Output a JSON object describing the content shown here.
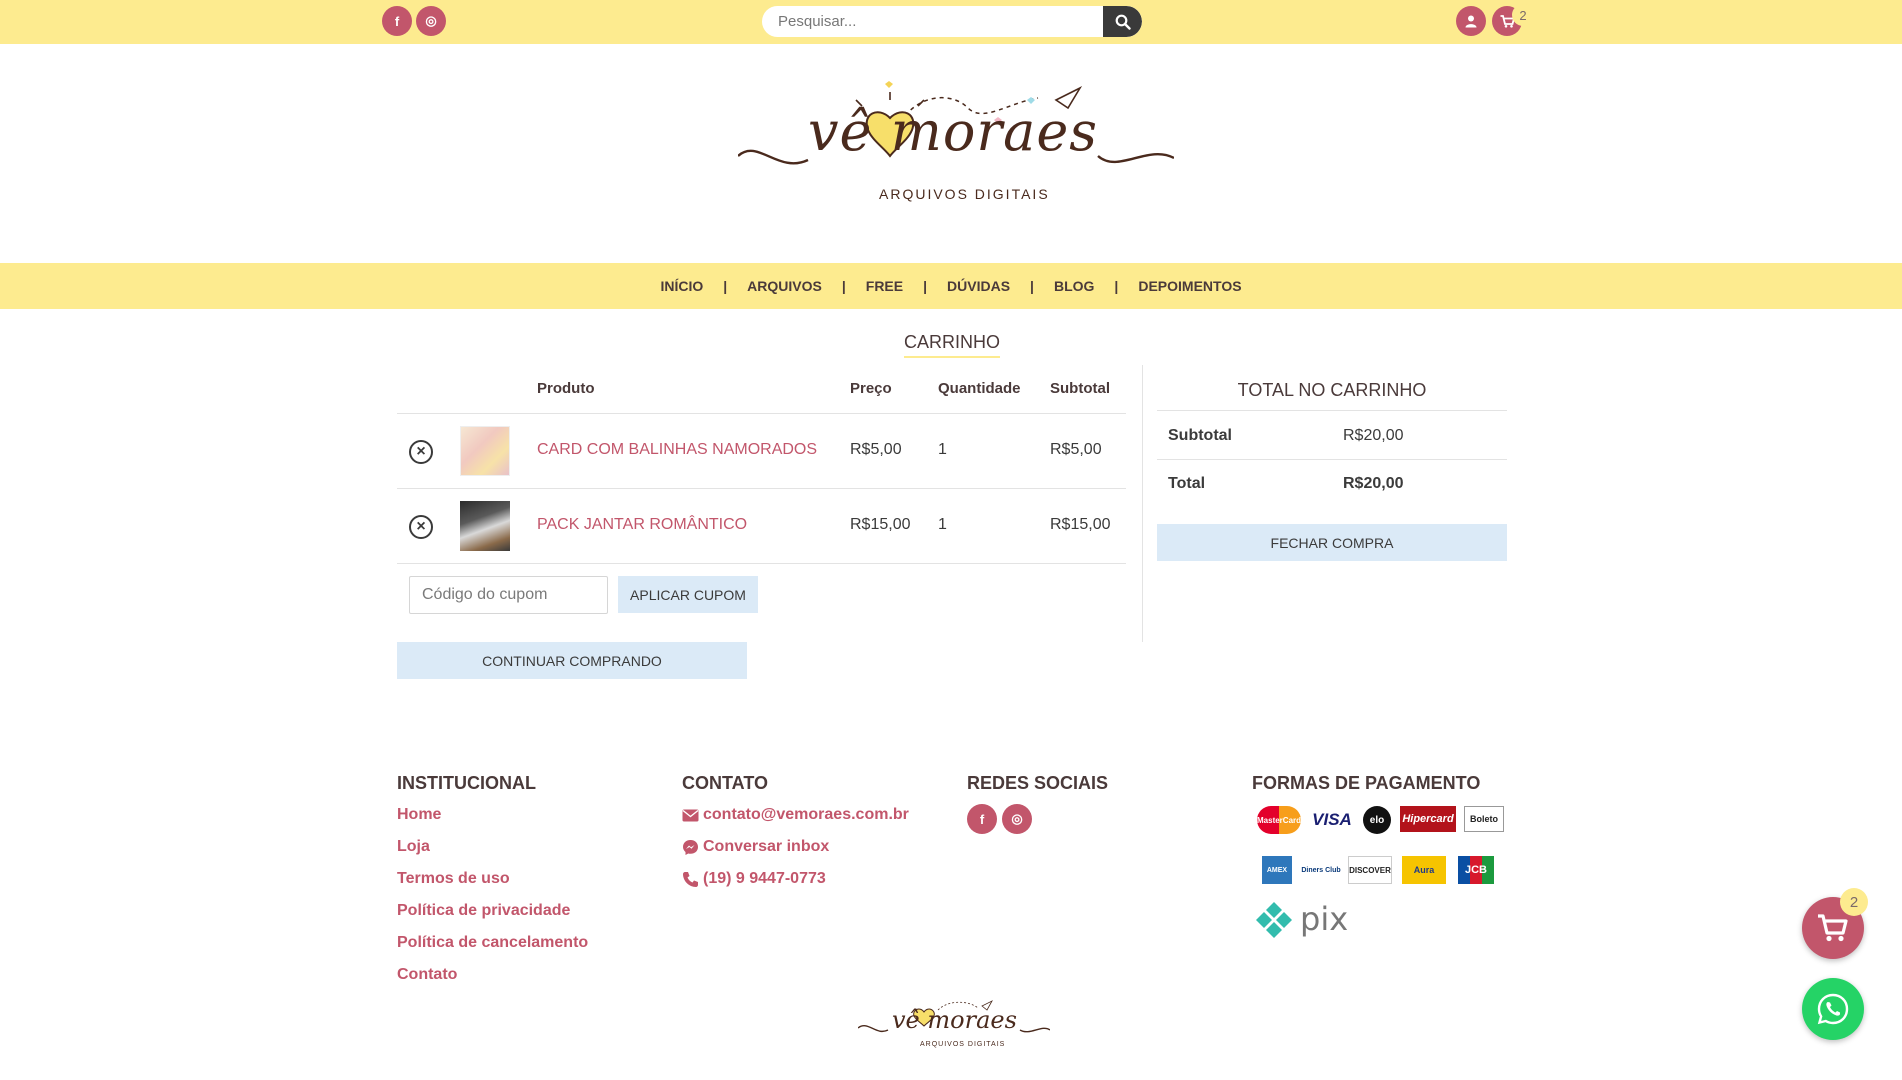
{
  "topbar": {
    "social": [
      {
        "icon": "facebook-icon",
        "glyph": "f"
      },
      {
        "icon": "instagram-icon",
        "glyph": "◎"
      }
    ],
    "search_placeholder": "Pesquisar...",
    "cart_count": "2"
  },
  "logo": {
    "name": "vê moraes",
    "subtitle": "ARQUIVOS DIGITAIS"
  },
  "nav": {
    "items": [
      "INÍCIO",
      "ARQUIVOS",
      "FREE",
      "DÚVIDAS",
      "BLOG",
      "DEPOIMENTOS"
    ],
    "separator": "|"
  },
  "cart": {
    "title": "CARRINHO",
    "headers": {
      "product": "Produto",
      "price": "Preço",
      "qty": "Quantidade",
      "subtotal": "Subtotal"
    },
    "items": [
      {
        "name": "CARD COM BALINHAS NAMORADOS",
        "price": "R$5,00",
        "qty": "1",
        "subtotal": "R$5,00"
      },
      {
        "name": "PACK JANTAR ROMÂNTICO",
        "price": "R$15,00",
        "qty": "1",
        "subtotal": "R$15,00"
      }
    ],
    "coupon_placeholder": "Código do cupom",
    "apply_coupon": "APLICAR CUPOM",
    "continue_shopping": "CONTINUAR COMPRANDO"
  },
  "totals": {
    "title": "TOTAL NO CARRINHO",
    "subtotal_label": "Subtotal",
    "subtotal_value": "R$20,00",
    "total_label": "Total",
    "total_value": "R$20,00",
    "checkout": "FECHAR COMPRA"
  },
  "footer": {
    "institucional": {
      "title": "INSTITUCIONAL",
      "links": [
        "Home",
        "Loja",
        "Termos de uso",
        "Política de privacidade",
        "Política de cancelamento",
        "Contato"
      ]
    },
    "contato": {
      "title": "CONTATO",
      "email": "contato@vemoraes.com.br",
      "inbox": "Conversar inbox",
      "phone": "(19) 9 9447-0773"
    },
    "redes": {
      "title": "REDES SOCIAIS"
    },
    "pagamento": {
      "title": "FORMAS DE PAGAMENTO",
      "methods": [
        "MasterCard",
        "VISA",
        "elo",
        "Hipercard",
        "Boleto",
        "AMEX",
        "Diners Club",
        "DISCOVER",
        "Aura",
        "JCB"
      ],
      "pix": "pix"
    }
  },
  "floating": {
    "cart_count": "2"
  },
  "colors": {
    "accent": "#c2566b",
    "band": "#fdeb8f",
    "button_light": "#dbeaf7"
  }
}
